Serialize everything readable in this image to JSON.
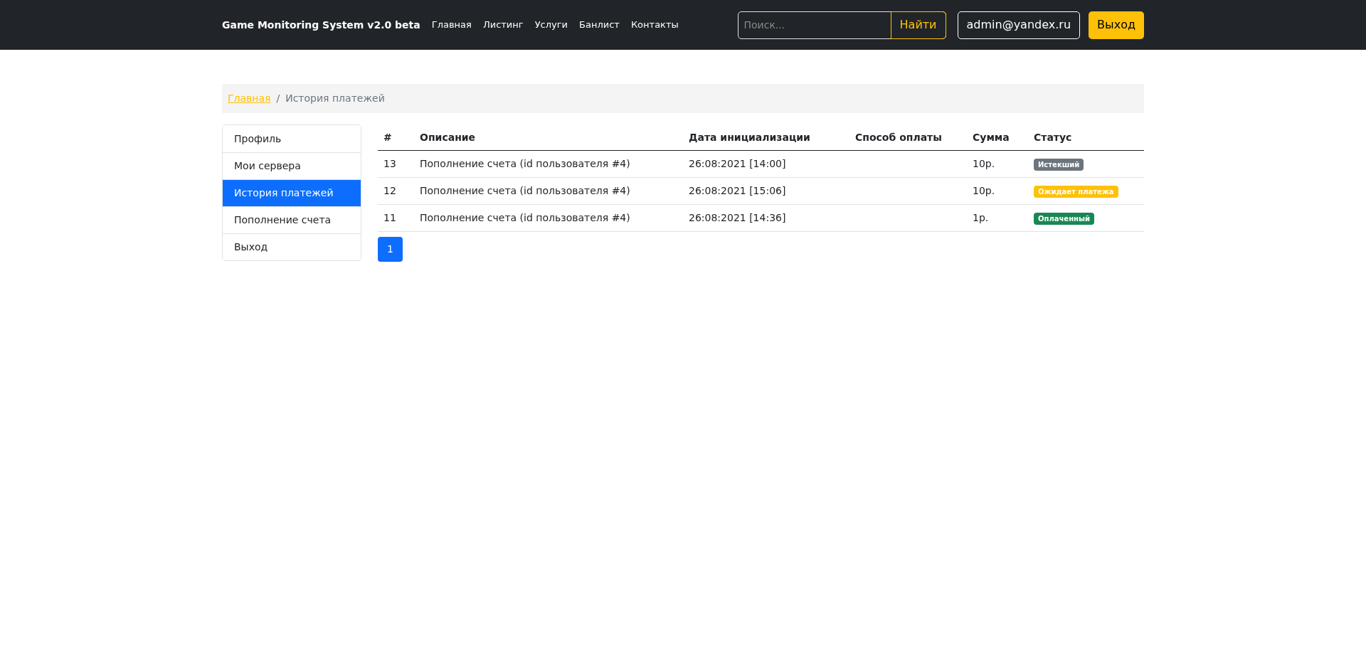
{
  "navbar": {
    "brand": "Game Monitoring System v2.0 beta",
    "links": [
      {
        "label": "Главная"
      },
      {
        "label": "Листинг"
      },
      {
        "label": "Услуги"
      },
      {
        "label": "Банлист"
      },
      {
        "label": "Контакты"
      }
    ],
    "search": {
      "placeholder": "Поиск...",
      "button": "Найти"
    },
    "user": "admin@yandex.ru",
    "logout": "Выход"
  },
  "breadcrumb": {
    "separator": "/",
    "items": [
      {
        "label": "Главная",
        "kind": "link"
      },
      {
        "label": "История платежей",
        "kind": "current"
      }
    ]
  },
  "sidebar": {
    "items": [
      {
        "label": "Профиль",
        "selected": false
      },
      {
        "label": "Мои сервера",
        "selected": false
      },
      {
        "label": "История платежей",
        "selected": true
      },
      {
        "label": "Пополнение счета",
        "selected": false
      },
      {
        "label": "Выход",
        "selected": false
      }
    ]
  },
  "table": {
    "columns": [
      "#",
      "Описание",
      "Дата инициализации",
      "Способ оплаты",
      "Сумма",
      "Статус"
    ],
    "rows": [
      {
        "id": "13",
        "description": "Пополнение счета (id пользователя #4)",
        "date": "26:08:2021 [14:00]",
        "sum": "10р.",
        "status": {
          "label": "Истекший",
          "color": "#6c757d"
        }
      },
      {
        "id": "12",
        "description": "Пополнение счета (id пользователя #4)",
        "date": "26:08:2021 [15:06]",
        "sum": "10р.",
        "status": {
          "label": "Ожидает платежа",
          "color": "#ffc107"
        }
      },
      {
        "id": "11",
        "description": "Пополнение счета (id пользователя #4)",
        "date": "26:08:2021 [14:36]",
        "sum": "1р.",
        "status": {
          "label": "Оплаченный",
          "color": "#198754"
        }
      }
    ]
  },
  "pagination": [
    {
      "label": "1",
      "selected": true
    }
  ]
}
